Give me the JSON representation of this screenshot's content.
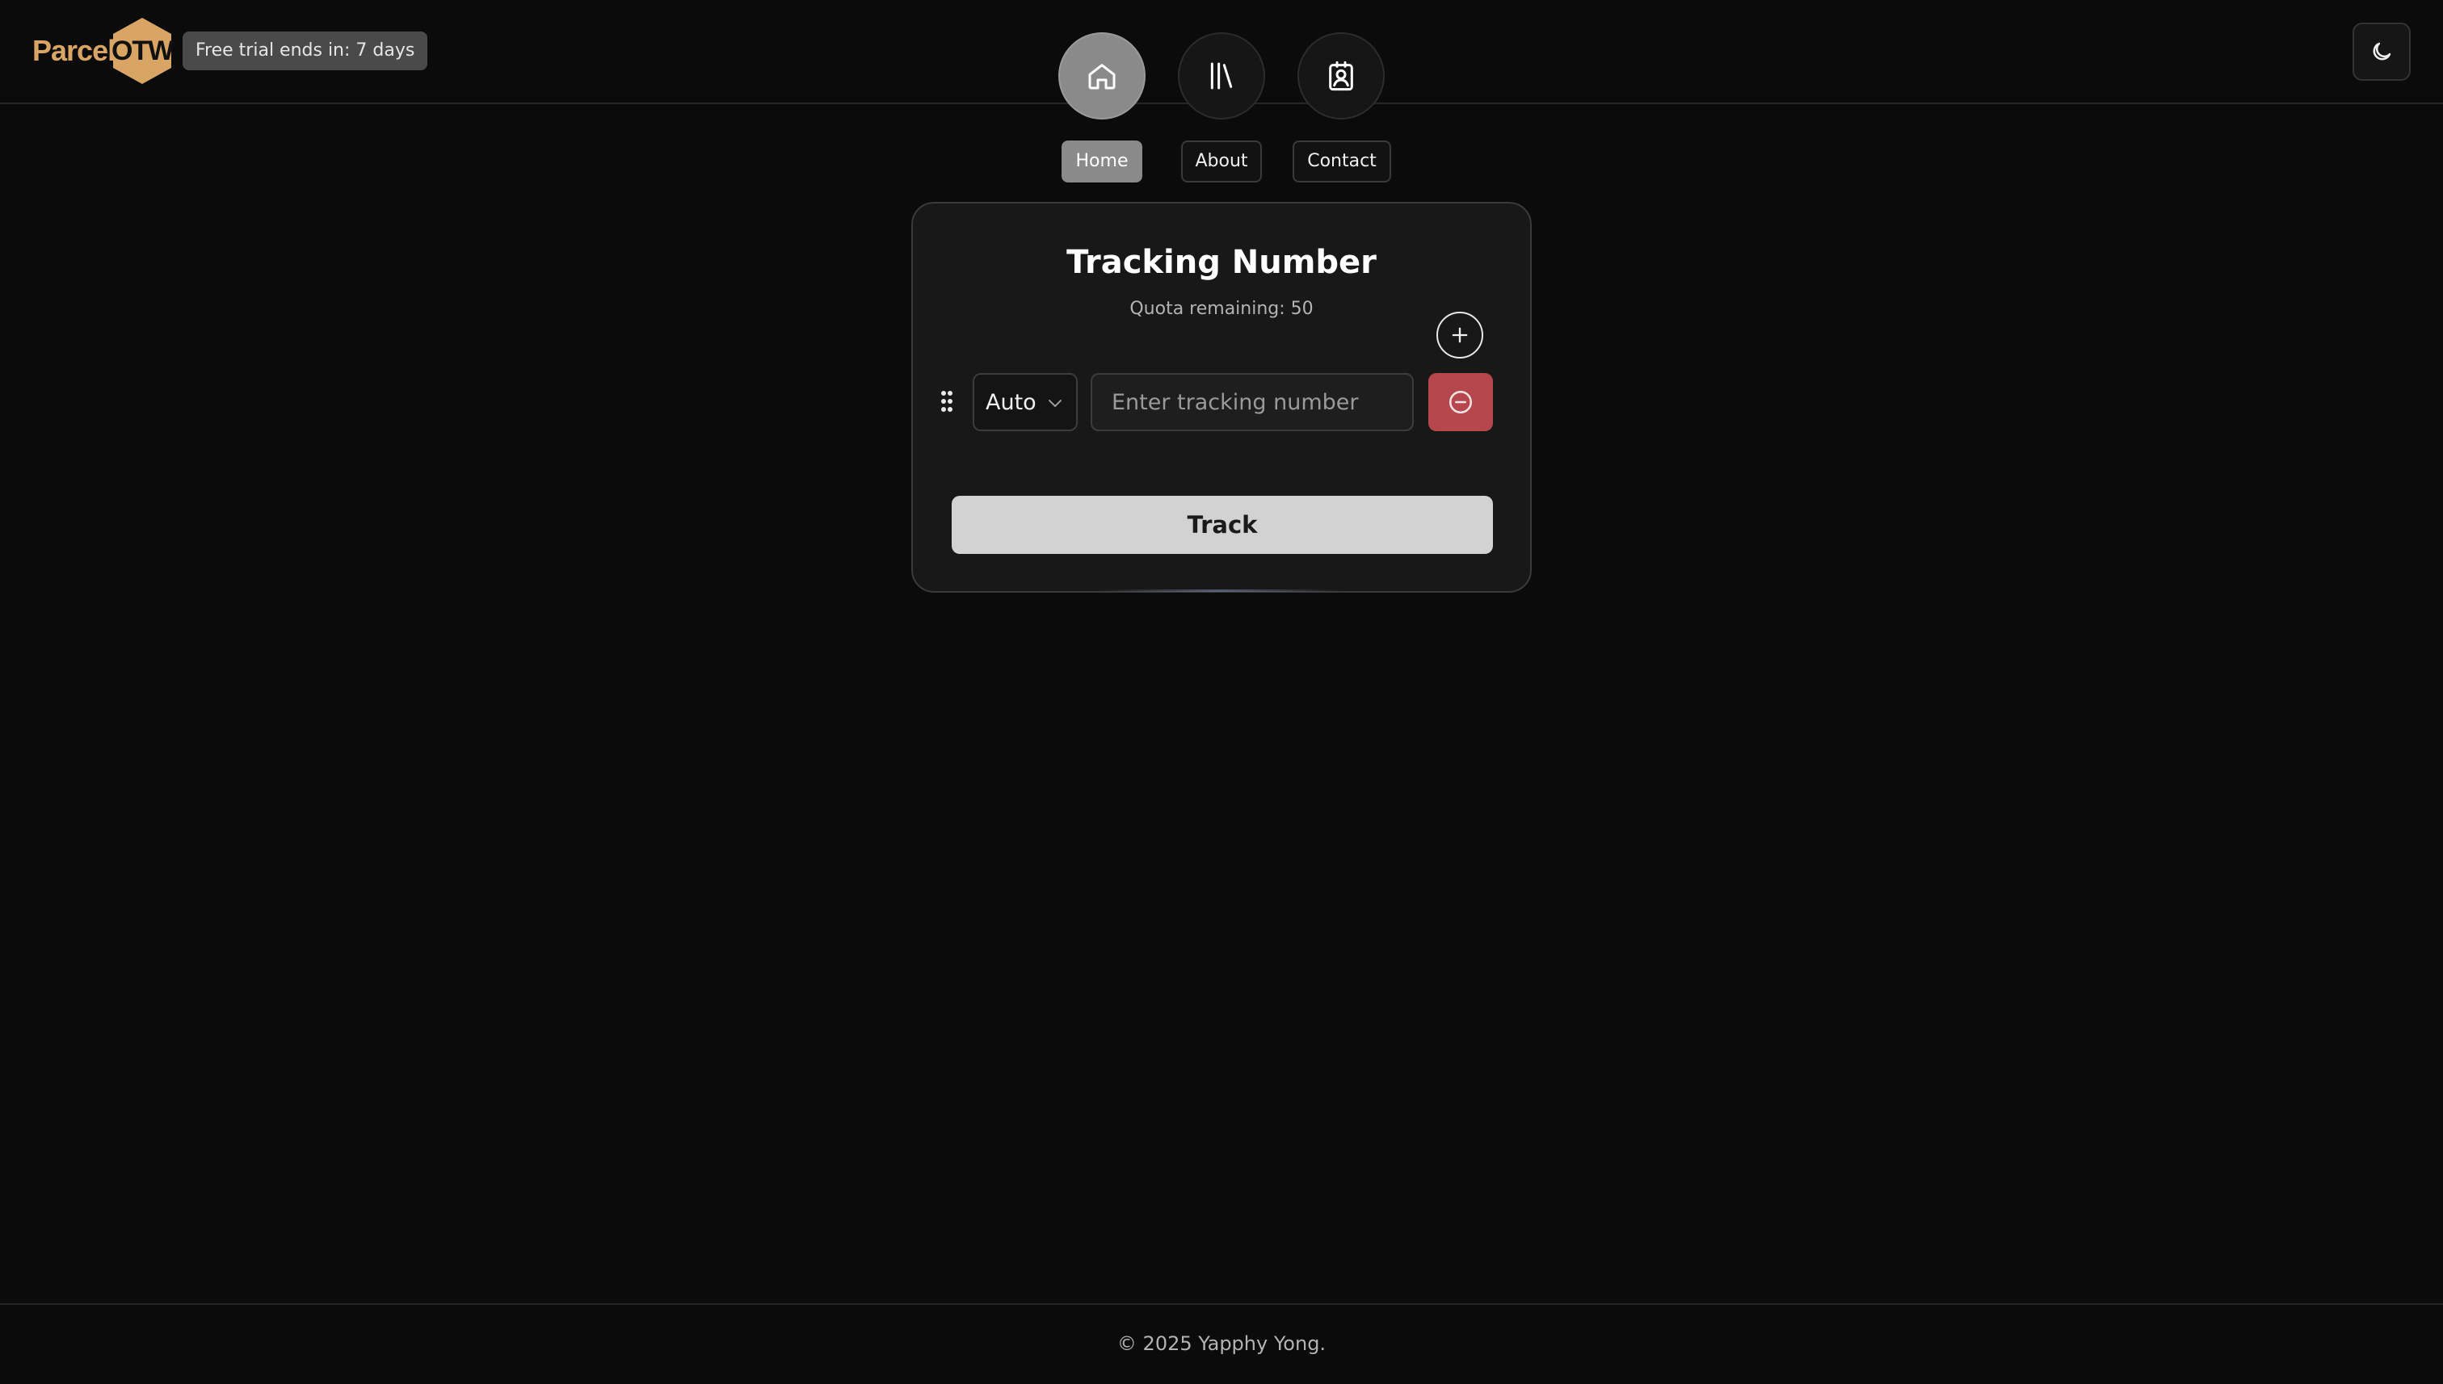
{
  "header": {
    "logo": {
      "text_left": "Parcel",
      "text_right": "OTW"
    },
    "trial_badge": "Free trial ends in: 7 days",
    "nav": [
      {
        "label": "Home",
        "icon": "home-icon",
        "active": true
      },
      {
        "label": "About",
        "icon": "library-icon",
        "active": false
      },
      {
        "label": "Contact",
        "icon": "contact-icon",
        "active": false
      }
    ],
    "theme_toggle_icon": "moon-icon"
  },
  "card": {
    "title": "Tracking Number",
    "quota": "Quota remaining: 50",
    "carrier_select": {
      "value": "Auto"
    },
    "tracking_input": {
      "placeholder": "Enter tracking number",
      "value": ""
    },
    "track_button": "Track"
  },
  "footer": {
    "copyright": "© 2025 Yapphy Yong."
  },
  "colors": {
    "background": "#0b0b0b",
    "brand": "#d9a564",
    "danger": "#b5474d",
    "active_nav": "#8a8a8a"
  }
}
